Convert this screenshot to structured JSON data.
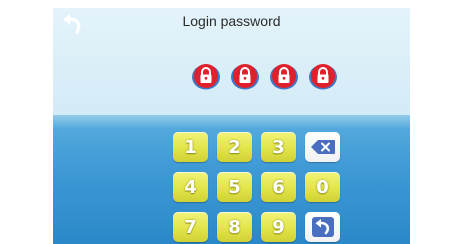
{
  "header": {
    "title": "Login password",
    "back_icon": "back-arrow-icon"
  },
  "pin": {
    "slots": 4,
    "entered": 0,
    "slot_icon": "padlock-icon",
    "slot_color": "#e0202a"
  },
  "keypad": {
    "keys": [
      {
        "label": "1"
      },
      {
        "label": "2"
      },
      {
        "label": "3"
      },
      {
        "label": "",
        "icon": "backspace-icon"
      },
      {
        "label": "4"
      },
      {
        "label": "5"
      },
      {
        "label": "6"
      },
      {
        "label": "0"
      },
      {
        "label": "7"
      },
      {
        "label": "8"
      },
      {
        "label": "9"
      },
      {
        "label": "",
        "icon": "enter-icon"
      }
    ],
    "key_color": "#e4e64c",
    "action_key_color": "#ffffff",
    "action_icon_color": "#4a6fc0"
  },
  "theme": {
    "top_background": "#d8eef8",
    "bottom_background": "#3f9ad6"
  }
}
